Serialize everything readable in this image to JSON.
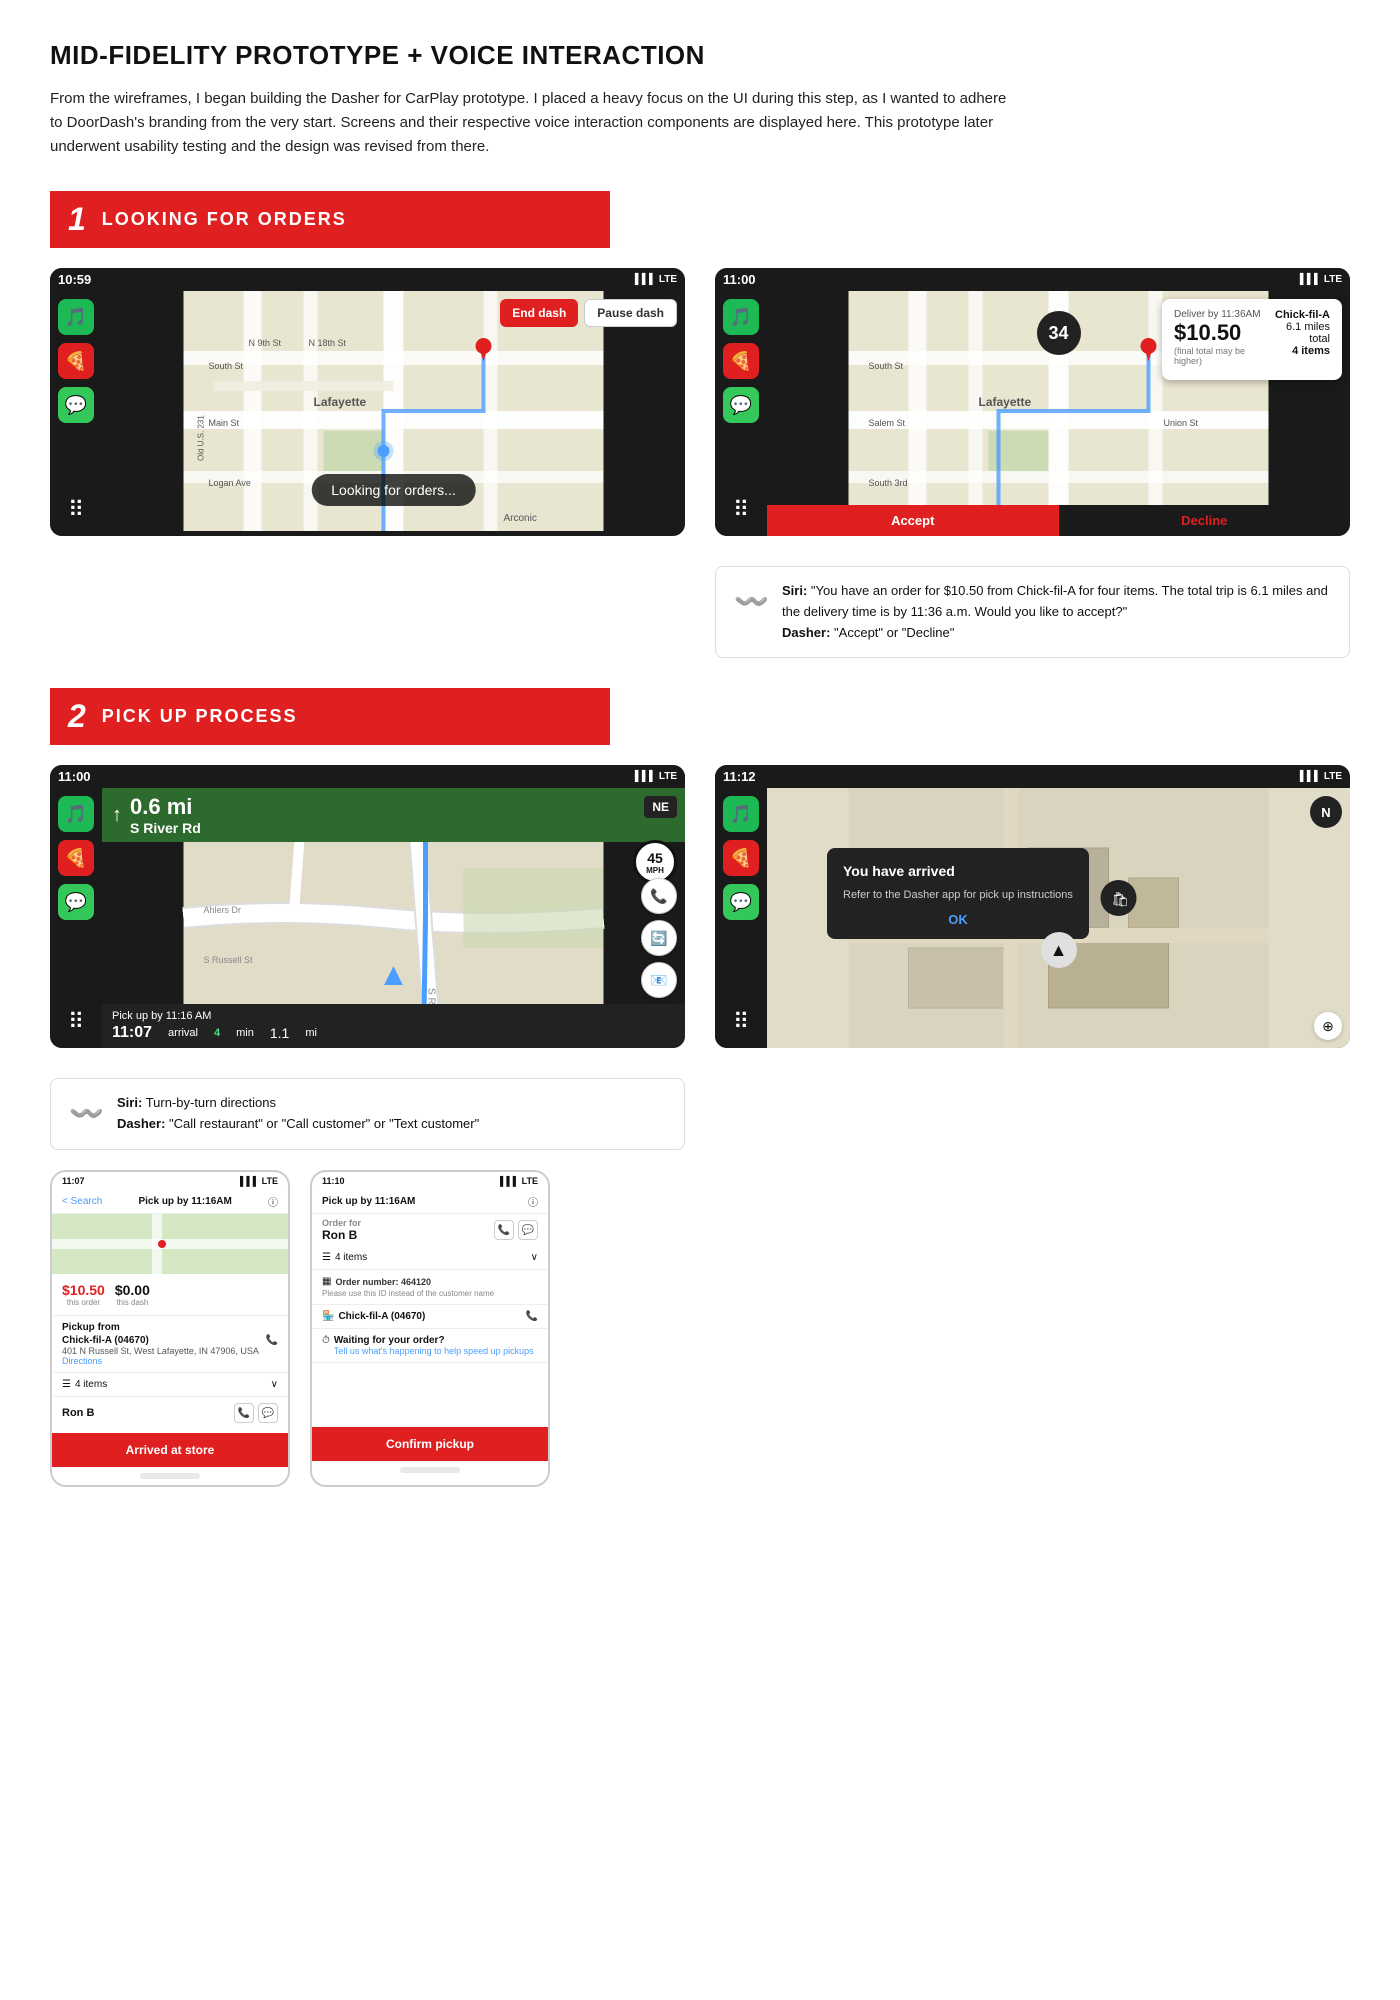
{
  "page": {
    "title": "MID-FIDELITY PROTOTYPE + VOICE INTERACTION",
    "description": "From the wireframes, I began building the Dasher for CarPlay prototype. I placed a heavy focus on the UI during this step, as I wanted to adhere to DoorDash's branding from the very start. Screens and their respective voice interaction components are displayed here. This prototype later underwent usability testing and the design was revised from there."
  },
  "section1": {
    "number": "1",
    "title": "LOOKING FOR ORDERS",
    "screen1": {
      "time": "10:59",
      "signal": "▌▌▌ LTE",
      "btn_end": "End dash",
      "btn_pause": "Pause dash",
      "overlay_text": "Looking for orders...",
      "city": "Lafayette",
      "landmark": "Arconic"
    },
    "screen2": {
      "time": "11:00",
      "signal": "▌▌▌ LTE",
      "deliver_by": "Deliver by 11:36AM",
      "price": "$10.50",
      "price_note": "(final total may be higher)",
      "restaurant": "Chick-fil-A",
      "miles": "6.1 miles total",
      "items": "4 items",
      "btn_accept": "Accept",
      "btn_decline": "Decline",
      "number_badge": "34"
    },
    "voice1": {
      "siri_label": "Siri:",
      "siri_text": "\"You have an order for $10.50 from Chick-fil-A for four items. The total trip is 6.1 miles and the delivery time is by 11:36 a.m. Would you like to accept?\"",
      "dasher_label": "Dasher:",
      "dasher_text": "\"Accept\" or \"Decline\""
    }
  },
  "section2": {
    "number": "2",
    "title": "PICK UP PROCESS",
    "screen3": {
      "time": "11:00",
      "signal": "▌▌▌ LTE",
      "direction": "NE",
      "distance": "0.6 mi",
      "street": "S River Rd",
      "speed": "45",
      "speed_unit": "MPH",
      "pickup_by": "Pick up by 11:16 AM",
      "arrival_time": "11:07",
      "arrival_label": "arrival",
      "min_value": "4",
      "min_label": "min",
      "miles_value": "1.1",
      "miles_label": "mi"
    },
    "screen4": {
      "time": "11:12",
      "signal": "▌▌▌ LTE",
      "compass": "N",
      "arrived_title": "You have arrived",
      "arrived_subtitle": "Refer to the Dasher app for pick up instructions",
      "btn_ok": "OK"
    },
    "voice2": {
      "siri_label": "Siri:",
      "siri_text": "Turn-by-turn directions",
      "dasher_label": "Dasher:",
      "dasher_text": "\"Call restaurant\" or \"Call customer\" or \"Text customer\""
    },
    "phone1": {
      "time": "11:07",
      "signal": "▌▌▌ LTE",
      "back_label": "< Search",
      "pickup_time": "Pick up by 11:16AM",
      "earning": "$10.50",
      "earning_label": "this order",
      "earning2": "$0.00",
      "earning2_label": "this dash",
      "pickup_from": "Pickup from",
      "store_name": "Chick-fil-A (04670)",
      "store_address": "401 N Russell St, West Lafayette, IN 47906, USA",
      "directions_link": "Directions",
      "items_label": "4 items",
      "customer_name": "Ron B",
      "btn_arrived": "Arrived at store"
    },
    "phone2": {
      "time": "11:10",
      "signal": "▌▌▌ LTE",
      "pickup_time": "Pick up by 11:16AM",
      "order_for_label": "Order for",
      "customer_name": "Ron B",
      "items_label": "4 items",
      "order_number_label": "Order number: 464120",
      "order_number_desc": "Please use this ID instead of the customer name",
      "store_name": "Chick-fil-A (04670)",
      "waiting_label": "Waiting for your order?",
      "waiting_link": "Tell us what's happening to help speed up pickups",
      "btn_confirm": "Confirm pickup"
    }
  }
}
